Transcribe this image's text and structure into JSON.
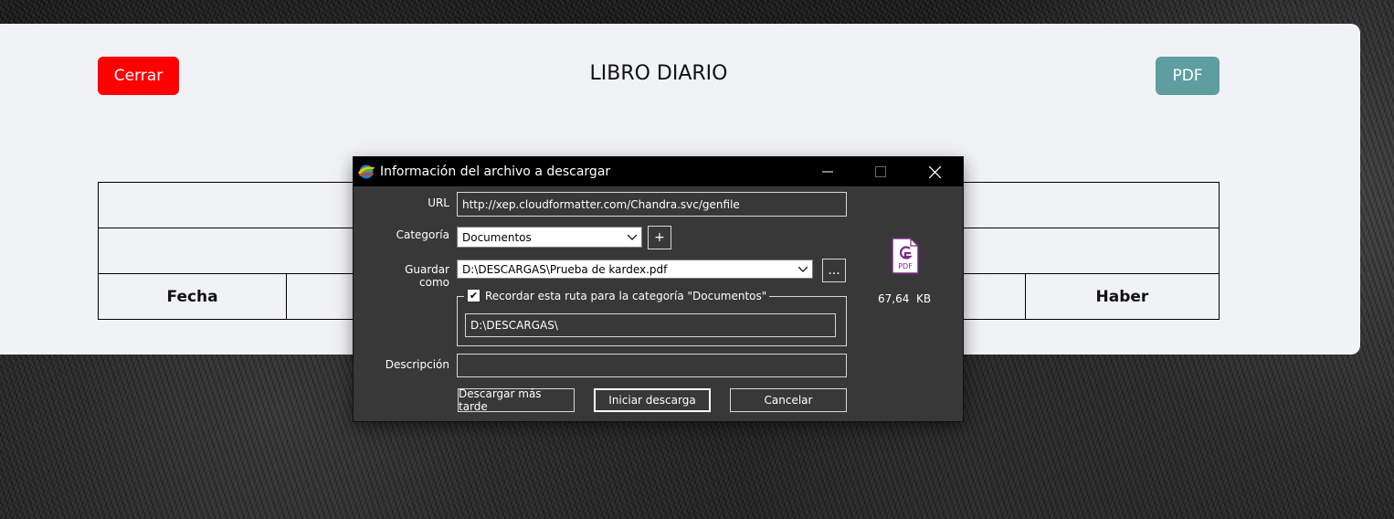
{
  "page": {
    "close_label": "Cerrar",
    "title": "LIBRO DIARIO",
    "pdf_label": "PDF"
  },
  "ledger": {
    "headers": [
      "Fecha",
      "",
      "",
      "",
      "Haber"
    ]
  },
  "dialog": {
    "title": "Información del archivo a descargar",
    "icon": "download-manager-globe-icon",
    "controls": {
      "minimize": "—",
      "maximize": "☐",
      "close": "✕"
    },
    "url_label": "URL",
    "url_value": "http://xep.cloudformatter.com/Chandra.svc/genfile",
    "category_label": "Categoría",
    "category_value": "Documentos",
    "add_category_label": "+",
    "save_as_label": "Guardar como",
    "save_as_value": "D:\\DESCARGAS\\Prueba de kardex.pdf",
    "browse_label": "...",
    "remember_checked": true,
    "remember_label": "Recordar esta ruta para la categoría \"Documentos\"",
    "remember_path": "D:\\DESCARGAS\\",
    "description_label": "Descripción",
    "description_value": "",
    "file_type_icon": "pdf-file-icon",
    "file_size": "67,64  KB",
    "buttons": {
      "later": "Descargar más tarde",
      "start": "Iniciar descarga",
      "cancel": "Cancelar"
    }
  },
  "colors": {
    "close_button": "#ff0000",
    "pdf_button": "#5f9ea0",
    "dialog_bg": "#383838",
    "titlebar_bg": "#000000"
  }
}
